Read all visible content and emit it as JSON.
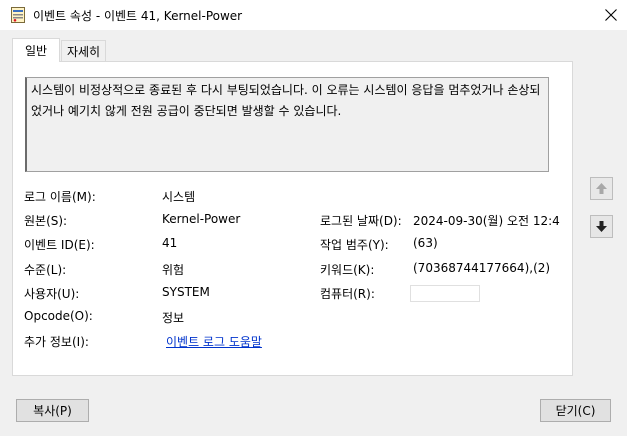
{
  "window": {
    "title": "이벤트 속성 - 이벤트 41, Kernel-Power"
  },
  "tabs": [
    {
      "label": "일반",
      "selected": true
    },
    {
      "label": "자세히",
      "selected": false
    }
  ],
  "description": "시스템이 비정상적으로 종료된 후 다시 부팅되었습니다. 이 오류는 시스템이 응답을 멈추었거나 손상되었거나 예기치 않게 전원 공급이 중단되면 발생할 수 있습니다.",
  "fields": {
    "log_name": {
      "label": "로그 이름(M):",
      "value": "시스템"
    },
    "source": {
      "label": "원본(S):",
      "value": "Kernel-Power"
    },
    "logged": {
      "label": "로그된 날짜(D):",
      "value": "2024-09-30(월) 오전 12:4"
    },
    "event_id": {
      "label": "이벤트 ID(E):",
      "value": "41"
    },
    "task_category": {
      "label": "작업 범주(Y):",
      "value": "(63)"
    },
    "level": {
      "label": "수준(L):",
      "value": "위험"
    },
    "keywords": {
      "label": "키워드(K):",
      "value": "(70368744177664),(2)"
    },
    "user": {
      "label": "사용자(U):",
      "value": "SYSTEM"
    },
    "computer": {
      "label": "컴퓨터(R):",
      "value": ""
    },
    "opcode": {
      "label": "Opcode(O):",
      "value": "정보"
    },
    "more_info": {
      "label": "추가 정보(I):",
      "link": "이벤트 로그 도움말"
    }
  },
  "buttons": {
    "copy": "복사(P)",
    "close": "닫기(C)"
  },
  "icons": {
    "app": "event-viewer-icon",
    "close": "close-icon",
    "up": "arrow-up-icon",
    "down": "arrow-down-icon"
  },
  "colors": {
    "link": "#0033cc",
    "background": "#f0f0f0"
  }
}
